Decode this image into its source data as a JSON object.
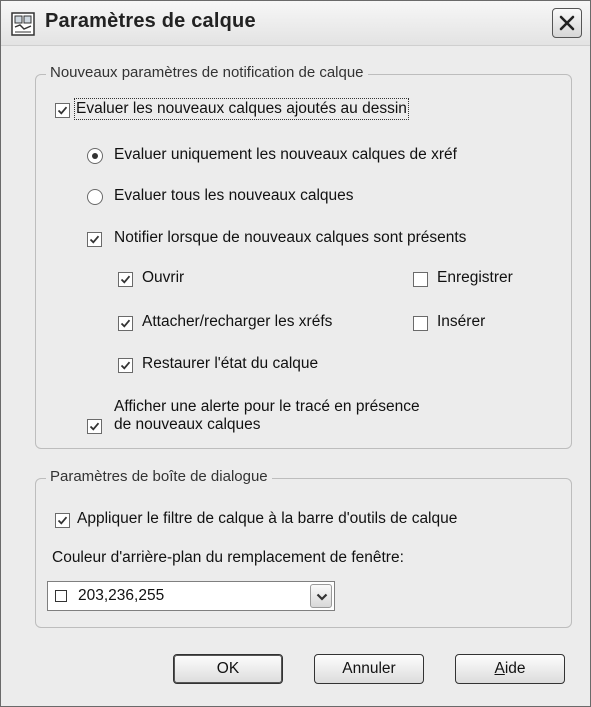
{
  "window": {
    "title": "Paramètres de calque"
  },
  "icons": {
    "title_icon": "layer-settings-icon",
    "close_icon": "close-x-icon"
  },
  "group_notification": {
    "legend": "Nouveaux paramètres de notification de calque",
    "evaluate_new_layers": {
      "label": "Evaluer les nouveaux calques ajoutés au dessin",
      "checked": true
    },
    "radio_xref_only": {
      "label": "Evaluer uniquement les nouveaux calques de xréf",
      "selected": true
    },
    "radio_all": {
      "label": "Evaluer tous les nouveaux calques",
      "selected": false
    },
    "notify": {
      "label": "Notifier lorsque de nouveaux calques sont présents",
      "checked": true
    },
    "open": {
      "label": "Ouvrir",
      "checked": true
    },
    "save": {
      "label": "Enregistrer",
      "checked": false
    },
    "attach_reload": {
      "label": "Attacher/recharger les xréfs",
      "checked": true
    },
    "insert": {
      "label": "Insérer",
      "checked": false
    },
    "restore_state": {
      "label": "Restaurer l'état du calque",
      "checked": true
    },
    "plot_alert_line1": "Afficher une alerte pour le tracé en présence",
    "plot_alert_line2": "de nouveaux calques",
    "plot_alert_checked": true
  },
  "group_dialog": {
    "legend": "Paramètres de boîte de dialogue",
    "apply_filter": {
      "label": "Appliquer le filtre de calque à la barre d'outils de calque",
      "checked": true
    },
    "bg_color_label": "Couleur d'arrière-plan du remplacement de fenêtre:",
    "bg_color_value": "203,236,255"
  },
  "buttons": {
    "ok": "OK",
    "cancel": "Annuler",
    "help": "Aide"
  }
}
